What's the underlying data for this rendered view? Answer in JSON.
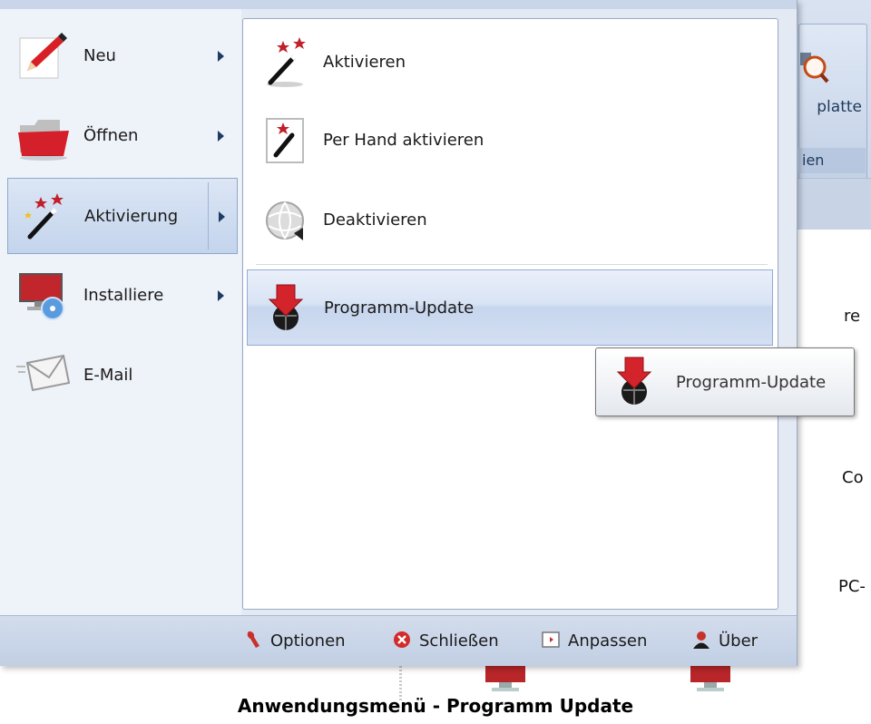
{
  "left_menu": [
    {
      "label": "Neu",
      "icon": "pencil-icon",
      "submenu": true
    },
    {
      "label": "Öffnen",
      "icon": "folder-icon",
      "submenu": true
    },
    {
      "label": "Aktivierung",
      "icon": "magic-wand-icon",
      "submenu": true,
      "selected": true
    },
    {
      "label": "Installiere",
      "icon": "install-monitor-icon",
      "submenu": true
    },
    {
      "label": "E-Mail",
      "icon": "envelope-icon",
      "submenu": false
    }
  ],
  "submenu": [
    {
      "label": "Aktivieren",
      "icon": "magic-wand-icon"
    },
    {
      "label": "Per Hand aktivieren",
      "icon": "manual-wand-icon"
    },
    {
      "label": "Deaktivieren",
      "icon": "globe-icon"
    },
    {
      "label": "Programm-Update",
      "icon": "update-arrow-icon",
      "highlighted": true
    }
  ],
  "tooltip": {
    "text": "Programm-Update",
    "icon": "update-arrow-icon"
  },
  "bottom_bar": [
    {
      "label": "Optionen",
      "icon": "wrench-icon"
    },
    {
      "label": "Schließen",
      "icon": "close-icon"
    },
    {
      "label": "Anpassen",
      "icon": "customize-icon"
    },
    {
      "label": "Über",
      "icon": "user-icon"
    }
  ],
  "background": {
    "ribbon_button_label": "platte",
    "ribbon_group_label": "ien",
    "text_fragments": [
      "re",
      "Co",
      "PC-"
    ]
  },
  "caption": "Anwendungsmenü - Programm Update"
}
